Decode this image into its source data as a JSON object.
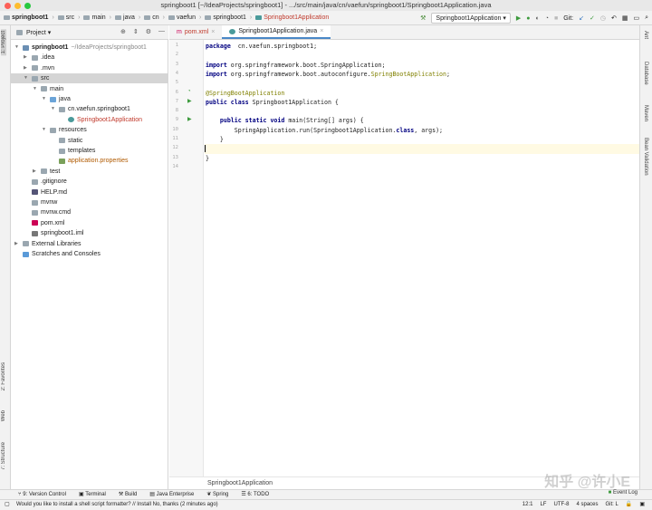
{
  "window": {
    "title": "springboot1 [~/IdeaProjects/springboot1] - .../src/main/java/cn/vaefun/springboot1/Springboot1Application.java"
  },
  "navbar": {
    "crumbs": [
      "springboot1",
      "src",
      "main",
      "java",
      "cn",
      "vaefun",
      "springboot1",
      "Springboot1Application"
    ]
  },
  "run": {
    "config": "Springboot1Application",
    "git_label": "Git:"
  },
  "left_tabs": [
    "1: Project",
    "2: Favorites",
    "Web",
    "7: Structure"
  ],
  "right_tabs": [
    "Ant",
    "Database",
    "Maven",
    "Bean Validation"
  ],
  "project": {
    "header": "Project",
    "tree": [
      {
        "label": "springboot1",
        "hint": "~/IdeaProjects/springboot1",
        "depth": 0,
        "arrow": "▼",
        "type": "module",
        "bold": true
      },
      {
        "label": ".idea",
        "depth": 1,
        "arrow": "▶",
        "type": "folder"
      },
      {
        "label": ".mvn",
        "depth": 1,
        "arrow": "▶",
        "type": "folder"
      },
      {
        "label": "src",
        "depth": 1,
        "arrow": "▼",
        "type": "folder",
        "selected": true
      },
      {
        "label": "main",
        "depth": 2,
        "arrow": "▼",
        "type": "folder"
      },
      {
        "label": "java",
        "depth": 3,
        "arrow": "▼",
        "type": "src-folder"
      },
      {
        "label": "cn.vaefun.springboot1",
        "depth": 4,
        "arrow": "▼",
        "type": "package"
      },
      {
        "label": "Springboot1Application",
        "depth": 5,
        "arrow": "",
        "type": "class",
        "color": "#c0392b"
      },
      {
        "label": "resources",
        "depth": 3,
        "arrow": "▼",
        "type": "folder"
      },
      {
        "label": "static",
        "depth": 4,
        "arrow": "",
        "type": "folder"
      },
      {
        "label": "templates",
        "depth": 4,
        "arrow": "",
        "type": "folder"
      },
      {
        "label": "application.properties",
        "depth": 4,
        "arrow": "",
        "type": "properties",
        "color": "#b05a00"
      },
      {
        "label": "test",
        "depth": 2,
        "arrow": "▶",
        "type": "folder"
      },
      {
        "label": ".gitignore",
        "depth": 1,
        "arrow": "",
        "type": "file"
      },
      {
        "label": "HELP.md",
        "depth": 1,
        "arrow": "",
        "type": "md"
      },
      {
        "label": "mvnw",
        "depth": 1,
        "arrow": "",
        "type": "file"
      },
      {
        "label": "mvnw.cmd",
        "depth": 1,
        "arrow": "",
        "type": "file"
      },
      {
        "label": "pom.xml",
        "depth": 1,
        "arrow": "",
        "type": "xml"
      },
      {
        "label": "springboot1.iml",
        "depth": 1,
        "arrow": "",
        "type": "iml"
      },
      {
        "label": "External Libraries",
        "depth": 0,
        "arrow": "▶",
        "type": "lib"
      },
      {
        "label": "Scratches and Consoles",
        "depth": 0,
        "arrow": "",
        "type": "scratch"
      }
    ]
  },
  "editor": {
    "tabs": [
      {
        "label": "pom.xml",
        "active": false
      },
      {
        "label": "Springboot1Application.java",
        "active": true
      }
    ],
    "lines": [
      [
        [
          "kw",
          "package"
        ],
        [
          "",
          "  cn.vaefun.springboot1;"
        ]
      ],
      [],
      [
        [
          "kw",
          "import"
        ],
        [
          "",
          " org.springframework.boot.SpringApplication;"
        ]
      ],
      [
        [
          "kw",
          "import"
        ],
        [
          "",
          " org.springframework.boot.autoconfigure."
        ],
        [
          "gr",
          "SpringBootApplication"
        ],
        [
          "",
          ";"
        ]
      ],
      [],
      [
        [
          "ann",
          "@SpringBootApplication"
        ]
      ],
      [
        [
          "kw",
          "public class"
        ],
        [
          "",
          " Springboot1Application {"
        ]
      ],
      [],
      [
        [
          "",
          "    "
        ],
        [
          "kw",
          "public static void"
        ],
        [
          "",
          " main(String[] args) {"
        ]
      ],
      [
        [
          "",
          "        SpringApplication.run(Springboot1Application."
        ],
        [
          "kw",
          "class"
        ],
        [
          "",
          ", args);"
        ]
      ],
      [
        [
          "",
          "    }"
        ]
      ],
      [],
      [
        [
          "",
          "}"
        ]
      ],
      []
    ],
    "current_line": 12,
    "breadcrumb": "Springboot1Application"
  },
  "toolwindows": [
    "9: Version Control",
    "Terminal",
    "Build",
    "Java Enterprise",
    "Spring",
    "6: TODO"
  ],
  "event_log": "Event Log",
  "status": {
    "message": "Would you like to install a shell script formatter? // Install   No, thanks (2 minutes ago)",
    "position": "12:1",
    "line_sep": "LF",
    "encoding": "UTF-8",
    "indent": "4 spaces",
    "vcs": "Git: L"
  },
  "watermark": "知乎 @许小E"
}
